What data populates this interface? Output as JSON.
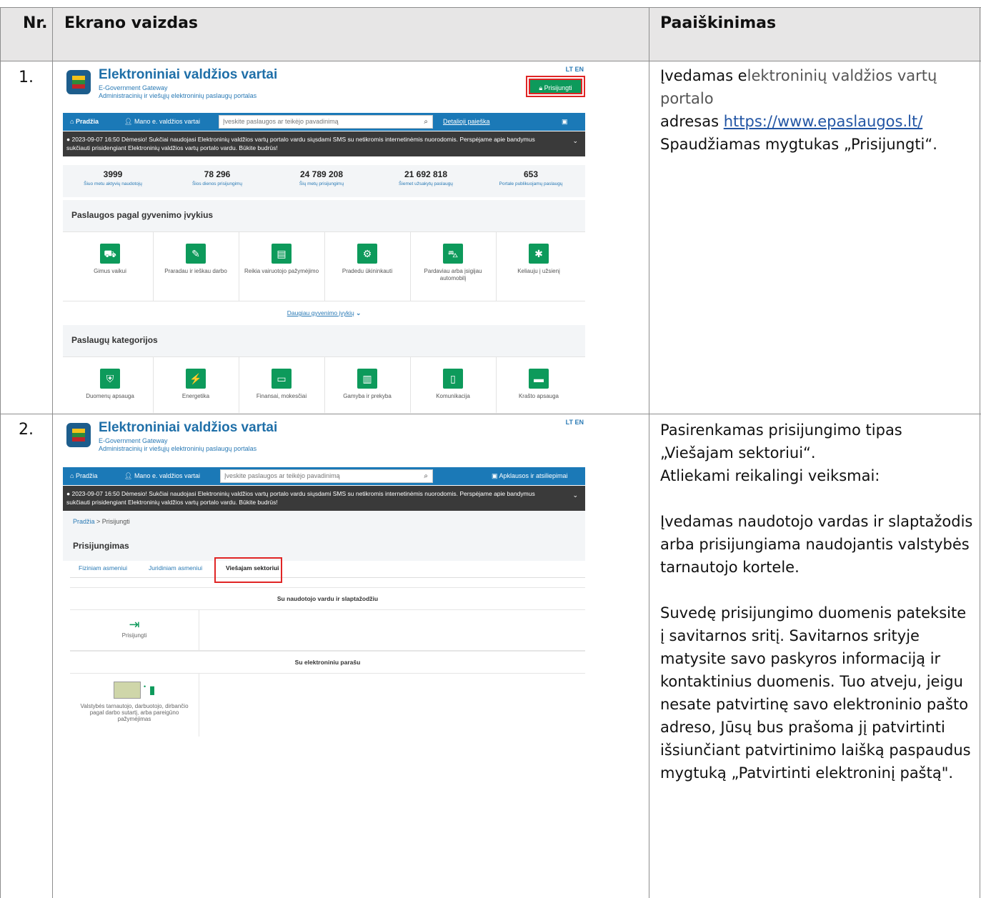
{
  "header": {
    "num": "Nr.",
    "screen": "Ekrano vaizdas",
    "explanation": "Paaiškinimas"
  },
  "rows": [
    {
      "num": "1.",
      "explanation": {
        "line1_pre": "Įvedamas e",
        "line1_post": "lektroninių valdžios vartų portalo",
        "line2_pre": "adresas ",
        "url": "https://www.epaslaugos.lt/",
        "line3": "Spaudžiamas mygtukas „Prisijungti“."
      },
      "screen": {
        "brand": "Elektroniniai valdžios vartai",
        "subtitle1": "E-Government Gateway",
        "subtitle2": "Administracinių ir viešųjų elektroninių paslaugų portalas",
        "lang": "LT EN",
        "login_button": "Prisijungti",
        "nav_home": "Pradžia",
        "nav_mine": "Mano e. valdžios vartai",
        "search_placeholder": "Įveskite paslaugos ar teikėjo pavadinimą",
        "nav_detail": "Detalioji paieška",
        "alert": "2023-09-07 16:50  Dėmesio! Sukčiai naudojasi Elektroninių valdžios vartų portalo vardu siųsdami SMS su netikromis internetinėmis nuorodomis. Perspėjame apie bandymus sukčiauti prisidengiant Elektroninių valdžios vartų portalo vardu. Būkite budrūs!",
        "stats": [
          {
            "value": "3999",
            "label": "Šiuo metu aktyvių naudotojų"
          },
          {
            "value": "78 296",
            "label": "Šios dienos prisijungimų"
          },
          {
            "value": "24 789 208",
            "label": "Šių metų prisijungimų"
          },
          {
            "value": "21 692 818",
            "label": "Šiemet užsakytų paslaugų"
          },
          {
            "value": "653",
            "label": "Portale publikuojamų paslaugų"
          }
        ],
        "section1": "Paslaugos pagal gyvenimo įvykius",
        "life_events": [
          "Gimus vaikui",
          "Praradau ir ieškau darbo",
          "Reikia vairuotojo pažymėjimo",
          "Pradedu ūkininkauti",
          "Pardaviau arba įsigijau automobilį",
          "Keliauju į užsienį"
        ],
        "more": "Daugiau gyvenimo įvykių",
        "section2": "Paslaugų kategorijos",
        "categories": [
          "Duomenų apsauga",
          "Energetika",
          "Finansai, mokesčiai",
          "Gamyba ir prekyba",
          "Komunikacija",
          "Krašto apsauga"
        ]
      }
    },
    {
      "num": "2.",
      "explanation": {
        "p1": "Pasirenkamas prisijungimo tipas „Viešajam sektoriui“.",
        "p2": "Atliekami reikalingi veiksmai:",
        "p3": "Įvedamas naudotojo vardas ir slaptažodis arba prisijungiama naudojantis valstybės tarnautojo kortele.",
        "p4": "Suvedę prisijungimo duomenis pateksite į savitarnos sritį. Savitarnos srityje matysite savo paskyros informaciją ir kontaktinius duomenis. Tuo atveju, jeigu nesate patvirtinę savo elektroninio pašto adreso, Jūsų bus prašoma jį patvirtinti išsiunčiant patvirtinimo laišką paspaudus mygtuką „Patvirtinti elektroninį paštą\"."
      },
      "screen": {
        "brand": "Elektroniniai valdžios vartai",
        "subtitle1": "E-Government Gateway",
        "subtitle2": "Administracinių ir viešųjų elektroninių paslaugų portalas",
        "lang": "LT EN",
        "nav_home": "Pradžia",
        "nav_mine": "Mano e. valdžios vartai",
        "search_placeholder": "Įveskite paslaugos ar teikėjo pavadinimą",
        "nav_survey": "Apklausos ir atsiliepimai",
        "alert": "2023-09-07 16:50  Dėmesio! Sukčiai naudojasi Elektroninių valdžios vartų portalo vardu siųsdami SMS su netikromis internetinėmis nuorodomis. Perspėjame apie bandymus sukčiauti prisidengiant Elektroninių valdžios vartų portalo vardu. Būkite budrūs!",
        "crumb_home": "Pradžia",
        "crumb_current": "Prisijungti",
        "page_title": "Prisijungimas",
        "tabs": [
          "Fiziniam asmeniui",
          "Juridiniam asmeniui",
          "Viešajam sektoriui"
        ],
        "band1": "Su naudotojo vardu ir slaptažodžiu",
        "login_label": "Prisijungti",
        "band2": "Su elektroniniu parašu",
        "card_label": "Valstybės tarnautojo, darbuotojo, dirbančio pagal darbo sutartį, arba pareigūno pažymėjimas"
      }
    }
  ]
}
